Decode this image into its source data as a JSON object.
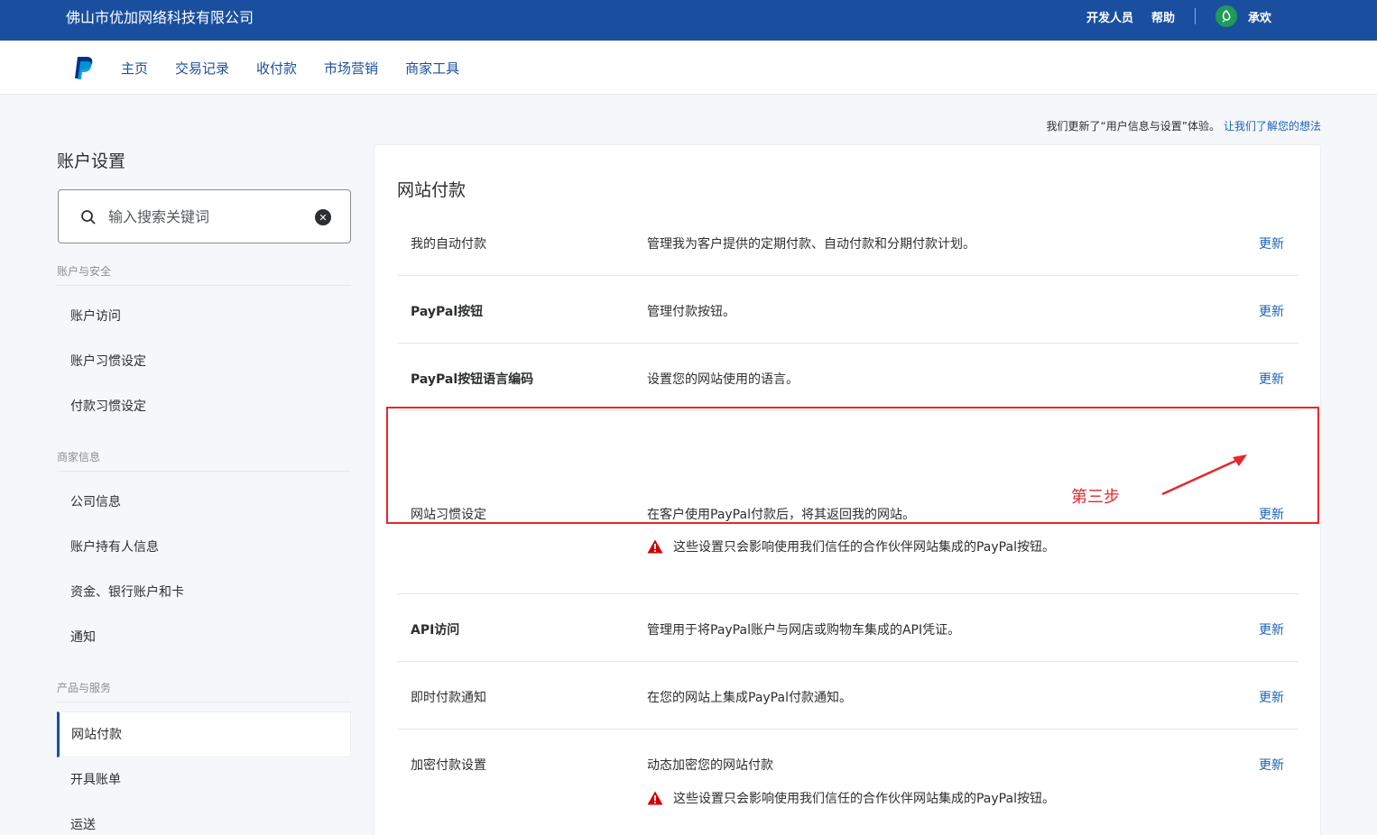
{
  "topbar": {
    "company": "佛山市优加网络科技有限公司",
    "links": [
      "开发人员",
      "帮助"
    ],
    "user_name": "承欢"
  },
  "nav": {
    "items": [
      "主页",
      "交易记录",
      "收付款",
      "市场营销",
      "商家工具"
    ]
  },
  "notice": {
    "text": "我们更新了“用户信息与设置”体验。",
    "link": "让我们了解您的想法"
  },
  "sidebar": {
    "title": "账户设置",
    "search_placeholder": "输入搜索关键词",
    "sections": [
      {
        "heading": "账户与安全",
        "items": [
          "账户访问",
          "账户习惯设定",
          "付款习惯设定"
        ]
      },
      {
        "heading": "商家信息",
        "items": [
          "公司信息",
          "账户持有人信息",
          "资金、银行账户和卡",
          "通知"
        ]
      },
      {
        "heading": "产品与服务",
        "items": [
          "网站付款",
          "开具账单",
          "运送"
        ],
        "active_item": "网站付款"
      }
    ]
  },
  "main": {
    "title": "网站付款",
    "rows": [
      {
        "name": "我的自动付款",
        "desc": "管理我为客户提供的定期付款、自动付款和分期付款计划。",
        "link": "更新"
      },
      {
        "name": "PayPal按钮",
        "desc": "管理付款按钮。",
        "link": "更新"
      },
      {
        "name": "PayPal按钮语言编码",
        "desc": "设置您的网站使用的语言。",
        "link": "更新"
      },
      {
        "name": "网站习惯设定",
        "desc": "在客户使用PayPal付款后，将其返回我的网站。",
        "warning": "这些设置只会影响使用我们信任的合作伙伴网站集成的PayPal按钮。",
        "link": "更新"
      },
      {
        "name": "API访问",
        "desc": "管理用于将PayPal账户与网店或购物车集成的API凭证。",
        "link": "更新"
      },
      {
        "name": "即时付款通知",
        "desc": "在您的网站上集成PayPal付款通知。",
        "link": "更新"
      },
      {
        "name": "加密付款设置",
        "desc": "动态加密您的网站付款",
        "warning": "这些设置只会影响使用我们信任的合作伙伴网站集成的PayPal按钮。",
        "link": "更新"
      }
    ]
  },
  "annotation": {
    "step_label": "第三步",
    "color": "#e8262b"
  },
  "colors": {
    "topbar": "#1a4fa0",
    "link": "#1a62b8",
    "warning": "#d20000"
  },
  "icons": [
    "paypal-logo-icon",
    "search-icon",
    "clear-icon",
    "warning-icon",
    "user-avatar-icon"
  ]
}
